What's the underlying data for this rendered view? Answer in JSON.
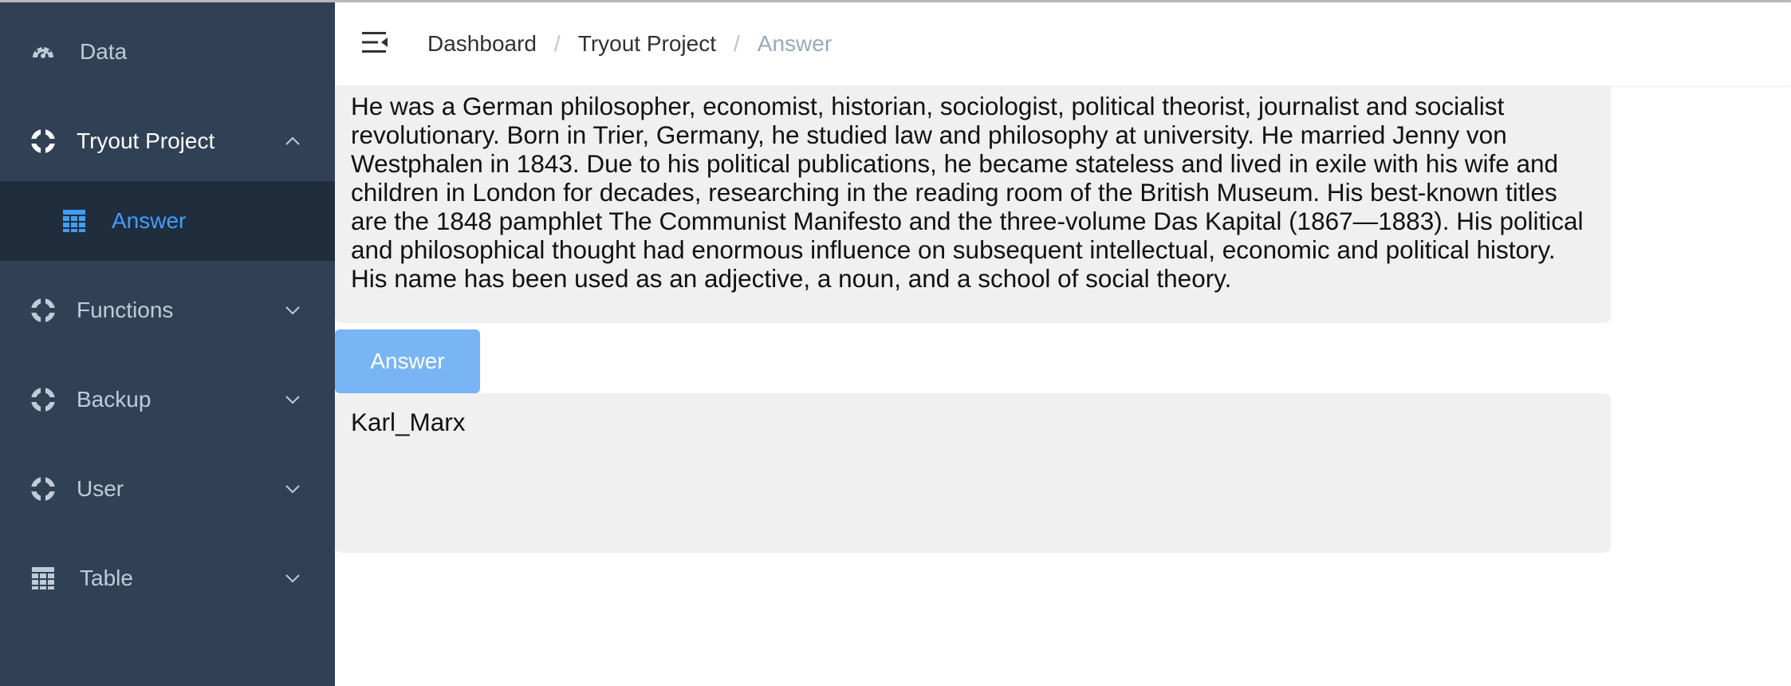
{
  "sidebar": {
    "items": [
      {
        "label": "Data",
        "icon": "dashboard-icon"
      },
      {
        "label": "Tryout Project",
        "icon": "lifebuoy-icon",
        "expanded": true
      },
      {
        "label": "Answer",
        "icon": "table-icon",
        "active": true
      },
      {
        "label": "Functions",
        "icon": "lifebuoy-icon"
      },
      {
        "label": "Backup",
        "icon": "lifebuoy-icon"
      },
      {
        "label": "User",
        "icon": "lifebuoy-icon"
      },
      {
        "label": "Table",
        "icon": "table-icon"
      }
    ],
    "colors": {
      "background": "#304156",
      "submenu_background": "#1f2d3d",
      "text": "#bfcbd9",
      "active_text": "#409eff"
    }
  },
  "header": {
    "breadcrumb": [
      "Dashboard",
      "Tryout Project",
      "Answer"
    ],
    "separator": "/"
  },
  "main": {
    "passage": "He was a German philosopher, economist, historian, sociologist, political theorist, journalist and socialist revolutionary. Born in Trier, Germany, he studied law and philosophy at university. He married Jenny von Westphalen in 1843. Due to his political publications, he became stateless and lived in exile with his wife and children in London for decades, researching in the reading room of the British Museum. His best-known titles are the 1848 pamphlet The Communist Manifesto and the three-volume Das Kapital (1867—1883). His political and philosophical thought had enormous influence on subsequent intellectual, economic and political history. His name has been used as an adjective, a noun, and a school of social theory.",
    "answer_button_label": "Answer",
    "answer_button_color": "#79b4f5",
    "result": "Karl_Marx"
  }
}
